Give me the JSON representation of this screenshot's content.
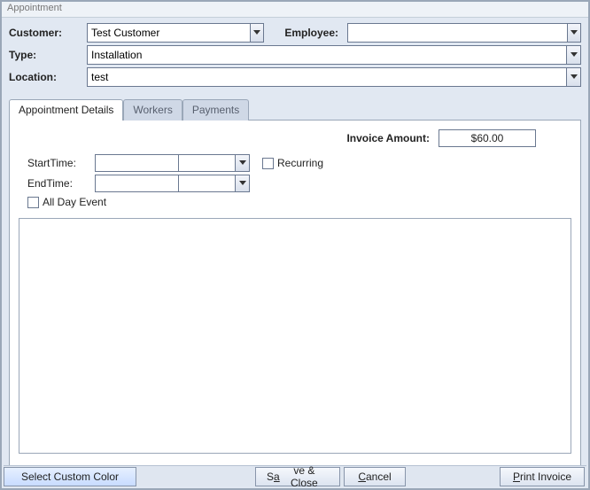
{
  "window": {
    "title": "Appointment"
  },
  "labels": {
    "customer": "Customer:",
    "employee": "Employee:",
    "type": "Type:",
    "location": "Location:",
    "invoice_amount": "Invoice Amount:",
    "start_time": "StartTime:",
    "end_time": "EndTime:",
    "recurring": "Recurring",
    "all_day": "All Day Event"
  },
  "fields": {
    "customer": "Test Customer",
    "employee": "",
    "type": "Installation",
    "location": "test",
    "invoice_amount": "$60.00",
    "start_date": "",
    "start_time": "",
    "end_date": "",
    "end_time": "",
    "recurring_checked": false,
    "all_day_checked": false,
    "notes": ""
  },
  "tabs": [
    {
      "label": "Appointment Details",
      "active": true
    },
    {
      "label": "Workers",
      "active": false
    },
    {
      "label": "Payments",
      "active": false
    }
  ],
  "buttons": {
    "select_color": "Select Custom Color",
    "save_close_pre": "S",
    "save_close_u": "a",
    "save_close_post": "ve & Close",
    "cancel_pre": "",
    "cancel_u": "C",
    "cancel_post": "ancel",
    "print_invoice_pre": "",
    "print_invoice_u": "P",
    "print_invoice_post": "rint Invoice"
  }
}
